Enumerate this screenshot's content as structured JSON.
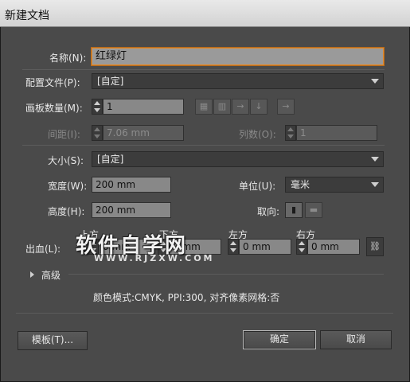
{
  "window": {
    "title": "新建文档"
  },
  "name": {
    "label": "名称(N):",
    "value": "红绿灯"
  },
  "profile": {
    "label": "配置文件(P):",
    "value": "[自定]"
  },
  "artboards": {
    "count_label": "画板数量(M):",
    "count_value": "1",
    "layout_icons": [
      "grid-by-row-icon",
      "grid-by-column-icon",
      "arrange-by-row-icon",
      "arrange-by-column-icon",
      "right-to-left-icon"
    ],
    "spacing_label": "间距(I):",
    "spacing_value": "7.06 mm",
    "columns_label": "列数(O):",
    "columns_value": "1"
  },
  "size": {
    "label": "大小(S):",
    "value": "[自定]"
  },
  "width": {
    "label": "宽度(W):",
    "value": "200 mm"
  },
  "height": {
    "label": "高度(H):",
    "value": "200 mm"
  },
  "units": {
    "label": "单位(U):",
    "value": "毫米"
  },
  "orientation": {
    "label": "取向:"
  },
  "bleed": {
    "label": "出血(L):",
    "top_label": "上方",
    "top_value": "0 mm",
    "bottom_label": "下方",
    "bottom_value": "0 mm",
    "left_label": "左方",
    "left_value": "0 mm",
    "right_label": "右方",
    "right_value": "0 mm"
  },
  "advanced": {
    "label": "高级"
  },
  "info": {
    "text": "颜色模式:CMYK, PPI:300, 对齐像素网格:否"
  },
  "buttons": {
    "templates": "模板(T)...",
    "ok": "确定",
    "cancel": "取消"
  },
  "watermark": {
    "text": "软件自学网",
    "url": "WWW.RJZXW.COM"
  },
  "colors": {
    "accent": "#e08a2c",
    "background": "#4a4a4a"
  }
}
